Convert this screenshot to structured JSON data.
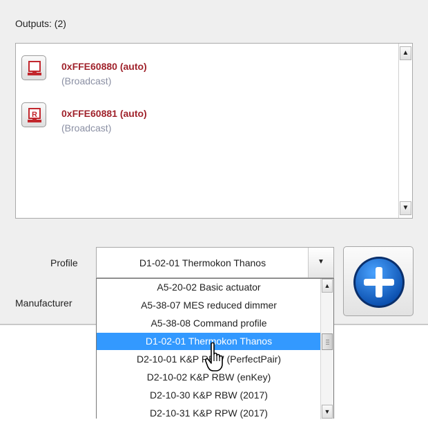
{
  "outputs": {
    "title": "Outputs: (2)",
    "items": [
      {
        "address": "0xFFE60880 (auto)",
        "subtitle": "(Broadcast)",
        "icon": "output-device-icon"
      },
      {
        "address": "0xFFE60881 (auto)",
        "subtitle": "(Broadcast)",
        "icon": "output-device-r-icon",
        "icon_letter": "R"
      }
    ]
  },
  "form": {
    "profile_label": "Profile",
    "manufacturer_label": "Manufacturer",
    "profile_value": "D1-02-01 Thermokon Thanos"
  },
  "dropdown": {
    "options": [
      "A5-20-02 Basic actuator",
      "A5-38-07 MES reduced dimmer",
      "A5-38-08 Command profile",
      "D1-02-01 Thermokon Thanos",
      "D2-10-01 K&P RBW (PerfectPair)",
      "D2-10-02 K&P RBW (enKey)",
      "D2-10-30 K&P RBW (2017)",
      "D2-10-31 K&P RPW (2017)"
    ],
    "selected_index": 3
  },
  "colors": {
    "accent_red": "#a0232c",
    "selection_blue": "#3399ff",
    "add_button_blue": "#1f6fd0"
  }
}
